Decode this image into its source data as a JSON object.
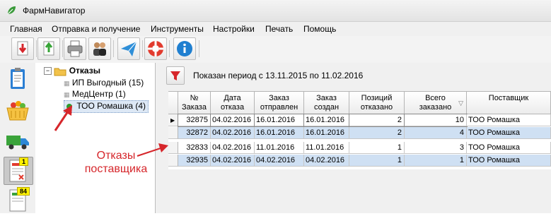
{
  "window": {
    "title": "ФармНавигатор"
  },
  "menu": [
    "Главная",
    "Отправка и получение",
    "Инструменты",
    "Настройки",
    "Печать",
    "Помощь"
  ],
  "toolbar": {
    "buttons": [
      "download-arrow-icon",
      "upload-arrow-icon",
      "printer-icon",
      "users-icon",
      "paper-plane-icon",
      "lifebuoy-icon",
      "info-icon"
    ]
  },
  "leftrail": {
    "items": [
      "clipboard-icon",
      "basket-icon",
      "truck-icon",
      "document-icon",
      "document-icon"
    ],
    "badges": [
      "1",
      "84"
    ]
  },
  "tree": {
    "root": "Отказы",
    "children": [
      "ИП Выгодный (15)",
      "МедЦентр (1)",
      "ТОО Ромашка (4)"
    ]
  },
  "period": "Показан период с 13.11.2015 по 11.02.2016",
  "grid": {
    "headers": [
      "№\nЗаказа",
      "Дата\nотказа",
      "Заказ\nотправлен",
      "Заказ\nсоздан",
      "Позиций\nотказано",
      "Всего\nзаказано",
      "Поставщик"
    ],
    "rows": [
      [
        "32875",
        "04.02.2016",
        "16.01.2016",
        "16.01.2016",
        "2",
        "10",
        "ТОО Ромашка"
      ],
      [
        "32872",
        "04.02.2016",
        "16.01.2016",
        "16.01.2016",
        "2",
        "4",
        "ТОО Ромашка"
      ],
      [
        "32833",
        "04.02.2016",
        "11.01.2016",
        "11.01.2016",
        "1",
        "3",
        "ТОО Ромашка"
      ],
      [
        "32935",
        "04.02.2016",
        "04.02.2016",
        "04.02.2016",
        "1",
        "1",
        "ТОО Ромашка"
      ]
    ]
  },
  "annotation": "Отказы\nпоставщика",
  "colors": {
    "accent": "#d6262b",
    "selected_row": "#cfe0f3",
    "folder": "#f2c24a",
    "status_dot": "#2e9b2e"
  }
}
